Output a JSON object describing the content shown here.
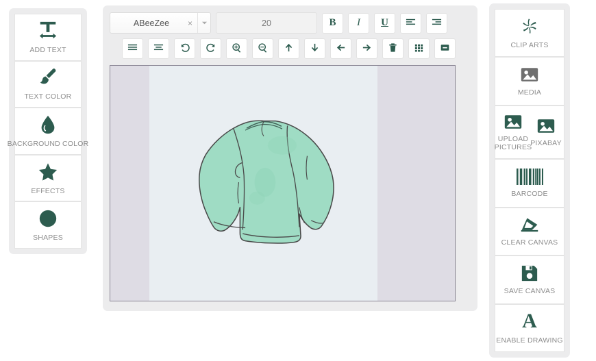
{
  "accent_color": "#2d5c4f",
  "muted_icon_color": "#6f6f6f",
  "label_color": "#8d8d8d",
  "left_sidebar": {
    "items": [
      {
        "label": "ADD TEXT",
        "icon": "text-width-icon"
      },
      {
        "label": "TEXT COLOR",
        "icon": "paint-brush-icon"
      },
      {
        "label": "BACKGROUND COLOR",
        "icon": "water-drop-icon"
      },
      {
        "label": "EFFECTS",
        "icon": "star-icon"
      },
      {
        "label": "SHAPES",
        "icon": "circle-icon"
      }
    ]
  },
  "toolbar": {
    "font": {
      "value": "ABeeZee",
      "clear_label": "×",
      "caret_label": "▾"
    },
    "font_size": {
      "value": "20"
    },
    "format_buttons": [
      {
        "label": "B",
        "name": "bold-button"
      },
      {
        "label": "I",
        "name": "italic-button"
      },
      {
        "label": "U",
        "name": "underline-button"
      }
    ],
    "align_buttons": [
      {
        "name": "align-left-button",
        "icon": "align-left-icon"
      },
      {
        "name": "align-right-button",
        "icon": "align-right-icon"
      }
    ],
    "row2_buttons": [
      {
        "name": "align-justify-button",
        "icon": "align-justify-icon"
      },
      {
        "name": "align-center-button",
        "icon": "align-center-icon"
      },
      {
        "name": "undo-button",
        "icon": "undo-icon"
      },
      {
        "name": "redo-button",
        "icon": "redo-icon"
      },
      {
        "name": "zoom-in-button",
        "icon": "zoom-in-icon"
      },
      {
        "name": "zoom-out-button",
        "icon": "zoom-out-icon"
      },
      {
        "name": "move-up-button",
        "icon": "arrow-up-icon"
      },
      {
        "name": "move-down-button",
        "icon": "arrow-down-icon"
      },
      {
        "name": "move-left-button",
        "icon": "arrow-left-icon"
      },
      {
        "name": "move-right-button",
        "icon": "arrow-right-icon"
      },
      {
        "name": "delete-button",
        "icon": "trash-icon"
      },
      {
        "name": "grid-button",
        "icon": "grid-icon"
      },
      {
        "name": "minimize-button",
        "icon": "minus-square-icon"
      }
    ]
  },
  "canvas": {
    "artwork": "sweater-illustration",
    "artwork_color": "#9fdcc4",
    "background_color": "#e9eef2",
    "surround_color": "#dedce4"
  },
  "right_sidebar": {
    "items": [
      {
        "label": "CLIP ARTS",
        "icon": "pinwheel-icon"
      },
      {
        "label": "MEDIA",
        "icon": "image-icon"
      },
      {
        "label": "BARCODE",
        "icon": "barcode-icon"
      },
      {
        "label": "CLEAR CANVAS",
        "icon": "eraser-icon"
      },
      {
        "label": "SAVE CANVAS",
        "icon": "floppy-disk-icon"
      },
      {
        "label": "ENABLE DRAWING",
        "icon": "letter-a-icon"
      }
    ],
    "upload_group": [
      {
        "label": "UPLOAD PICTURES",
        "icon": "image-icon"
      },
      {
        "label": "PIXABAY",
        "icon": "image-icon"
      }
    ]
  }
}
